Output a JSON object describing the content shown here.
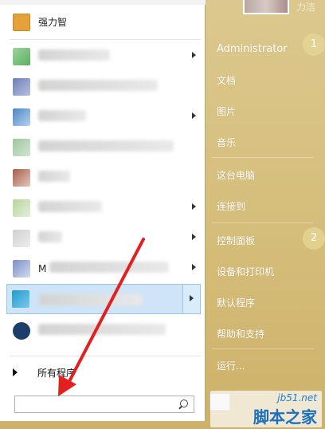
{
  "pinned": {
    "label": "强力智"
  },
  "left_items": [
    {
      "has_arrow": true
    },
    {
      "has_arrow": false
    },
    {
      "has_arrow": true
    },
    {
      "has_arrow": false
    },
    {
      "has_arrow": false
    },
    {
      "has_arrow": true
    },
    {
      "has_arrow": true
    },
    {
      "label_prefix": "M",
      "has_arrow": true
    },
    {
      "highlighted": true,
      "has_arrow": true
    },
    {
      "has_arrow": false
    }
  ],
  "all_programs": {
    "label": "所有程序"
  },
  "search": {
    "placeholder": "",
    "value": ""
  },
  "user": {
    "name": "Administrator",
    "side_text": "力洁"
  },
  "right_menu": {
    "group1": [
      "文档",
      "图片",
      "音乐"
    ],
    "group2": [
      "这台电脑",
      "连接到"
    ],
    "group3": [
      "控制面板",
      "设备和打印机",
      "默认程序",
      "帮助和支持"
    ],
    "run": "运行..."
  },
  "badges": [
    "1",
    "2"
  ],
  "watermark": {
    "line1": "jb51.net",
    "line2": "脚本之家"
  },
  "colors": {
    "accent_background": "#d4bc78",
    "highlight": "#cfe4f7",
    "arrow": "#e41f1f",
    "watermark": "#1b6fbd"
  }
}
